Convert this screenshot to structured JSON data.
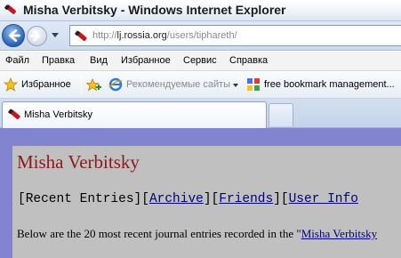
{
  "window": {
    "title": "Misha Verbitsky - Windows Internet Explorer"
  },
  "address": {
    "scheme": "http://",
    "domain": "lj.rossia.org",
    "path": "/users/tiphareth/"
  },
  "menu": {
    "items": [
      "Файл",
      "Правка",
      "Вид",
      "Избранное",
      "Сервис",
      "Справка"
    ]
  },
  "favorites": {
    "label": "Избранное",
    "recommended": "Рекомендуемые сайты",
    "bookmark": "free bookmark management..."
  },
  "tabs": {
    "active_label": "Misha Verbitsky"
  },
  "page": {
    "heading": "Misha Verbitsky",
    "nav": {
      "open1": "[",
      "recent": "Recent Entries",
      "sep1": "][",
      "archive": "Archive",
      "sep2": "][",
      "friends": "Friends",
      "sep3": "][",
      "userinfo": "User Info"
    },
    "intro_text": "Below are the 20 most recent journal entries recorded in the \"",
    "intro_link": "Misha Verbitsky"
  },
  "colors": {
    "page_bg": "#8284cf",
    "content_bg": "#c0c0c0",
    "heading": "#8b1a1a",
    "link": "#00007a"
  }
}
